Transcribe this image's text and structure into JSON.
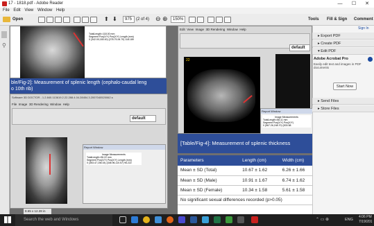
{
  "window": {
    "title": "17 - 1818.pdf - Adobe Reader"
  },
  "menu": [
    "File",
    "Edit",
    "View",
    "Window",
    "Help"
  ],
  "toolbar": {
    "open_label": "Open",
    "page_current": "975",
    "page_total": "(2 of 4)",
    "zoom": "150%",
    "tools_label": "Tools",
    "fill_sign_label": "Fill & Sign",
    "comment_label": "Comment"
  },
  "page": {
    "fig2_caption": "ble/Fig-2]: Measurement of splenic length (cephalo-caudal leng",
    "fig2_caption_line2": "o 10th rib)",
    "fig4_caption": "[Table/Fig-4]: Measurement of splenic thickness",
    "shot1_meas": [
      "TotalLength=118.00 mm",
      "Segment  Pos(X/Y)   Pos(X/Y)   Length (mm)",
      "0   (342.00,183.00)  (278.79,94.79)  118.189"
    ],
    "shot2_title": "Software 3D DOCTOR - 1.2.840.113619.2.22.288.4.04.28454.3.2007040520062.s",
    "shot2_menu": [
      "File",
      "Image",
      "3D Rendering",
      "Window",
      "Help"
    ],
    "shot2_default": "default",
    "shot2_report": "Report Window",
    "shot2_meas_title": "Image Measurements",
    "shot2_meas": [
      "TotalLength=96.22 mm",
      "Segment  Pos(X/Y)   Pos(X/Y)   Length (mm)",
      "0   (353.47,156.04)  (348.96,110.57)  96.222"
    ],
    "shot3_menu": [
      "Edit",
      "View",
      "Image",
      "3D Rendering",
      "Window",
      "Help"
    ],
    "shot3_default": "default",
    "shot3_report": "Report Window",
    "shot3_meas_title": "Image Measurements",
    "shot3_meas": [
      "TotalLength=58.11 mm",
      "Segment  Pos(X/Y)   Pos(X/Y)",
      "0   (567.26,248.70)  (533.58"
    ],
    "ct_label": "22",
    "status_size": "8.65 x 12.28 in",
    "table": {
      "headers": [
        "Parameters",
        "Length (cm)",
        "Width (cm)",
        "Th"
      ],
      "rows": [
        [
          "Mean ± SD (Total)",
          "10.67 ± 1.62",
          "6.26 ± 1.66",
          "4"
        ],
        [
          "Mean ± SD (Male)",
          "10.91 ± 1.67",
          "6.74 ± 1.62",
          "4"
        ],
        [
          "Mean ± SD (Female)",
          "10.34 ± 1.58",
          "5.61 ± 1.58",
          "4"
        ]
      ],
      "footnote": "No significant sexual differences recorded (p>0.05)"
    }
  },
  "rightpanel": {
    "sign_in": "Sign In",
    "items": [
      "Export PDF",
      "Create PDF",
      "Edit PDF"
    ],
    "acrobat_title": "Adobe Acrobat Pro",
    "acrobat_desc": "Easily edit text and images in PDF documents",
    "start_now": "Start Now",
    "send_files": "Send Files",
    "store_files": "Store Files"
  },
  "taskbar": {
    "search_placeholder": "Search the web and Windows",
    "time": "4:06 PM",
    "date": "7/19/201",
    "lang": "ENG"
  },
  "colors": {
    "accent_blue": "#2e4e99",
    "title_blue": "#1a3f8c"
  }
}
